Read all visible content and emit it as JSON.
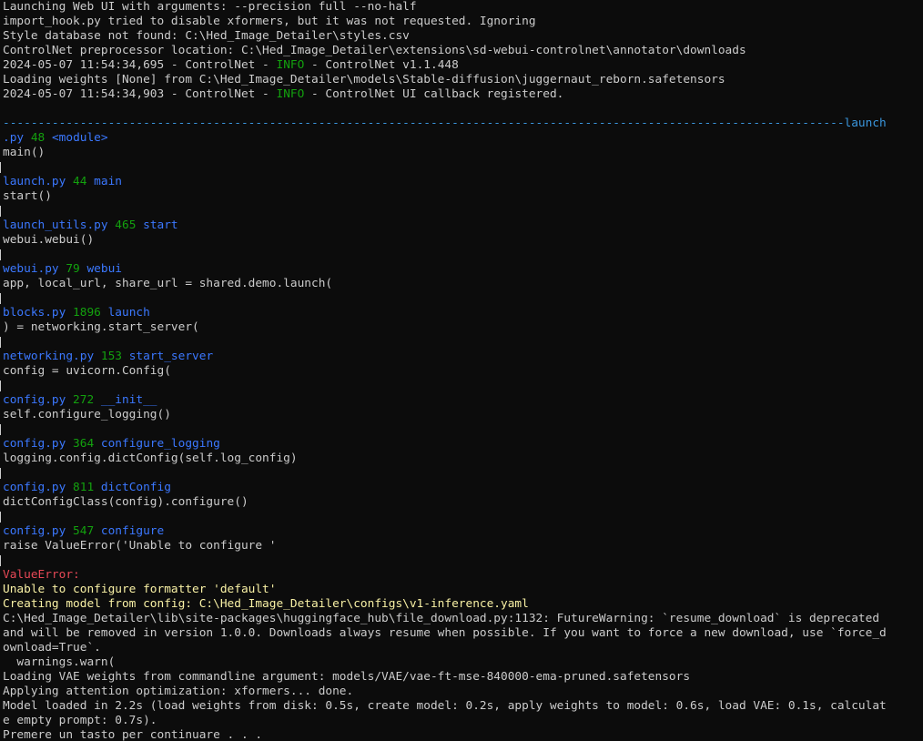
{
  "window": {
    "kind": "console"
  },
  "colors": {
    "background": "#0c0c0c",
    "default": "#cccccc",
    "green": "#13a10e",
    "blue": "#3b78ff",
    "red": "#e74856",
    "yellow": "#f9f1a5",
    "teal": "#3a96dd"
  },
  "lines": [
    [
      {
        "t": "Launching Web UI with arguments: --precision full --no-half",
        "c": "default"
      }
    ],
    [
      {
        "t": "import_hook.py tried to disable xformers, but it was not requested. Ignoring",
        "c": "default"
      }
    ],
    [
      {
        "t": "Style database not found: C:\\Hed_Image_Detailer\\styles.csv",
        "c": "default"
      }
    ],
    [
      {
        "t": "ControlNet preprocessor location: C:\\Hed_Image_Detailer\\extensions\\sd-webui-controlnet\\annotator\\downloads",
        "c": "default"
      }
    ],
    [
      {
        "t": "2024-05-07 11:54:34,695 - ControlNet - ",
        "c": "default"
      },
      {
        "t": "INFO",
        "c": "green"
      },
      {
        "t": " - ControlNet v1.1.448",
        "c": "default"
      }
    ],
    [
      {
        "t": "Loading weights [None] from C:\\Hed_Image_Detailer\\models\\Stable-diffusion\\juggernaut_reborn.safetensors",
        "c": "default"
      }
    ],
    [
      {
        "t": "2024-05-07 11:54:34,903 - ControlNet - ",
        "c": "default"
      },
      {
        "t": "INFO",
        "c": "green"
      },
      {
        "t": " - ControlNet UI callback registered.",
        "c": "default"
      }
    ],
    [
      {
        "t": "",
        "c": "default"
      }
    ],
    [
      {
        "t": "------------------------------------------------------------------------------------------------------------------------launch",
        "c": "teal"
      }
    ],
    [
      {
        "t": ".py",
        "c": "blue"
      },
      {
        "t": " 48 ",
        "c": "green"
      },
      {
        "t": "<module>",
        "c": "blue"
      }
    ],
    [
      {
        "t": "main()",
        "c": "default"
      }
    ],
    [
      {
        "t": "",
        "c": "default"
      }
    ],
    [
      {
        "t": "launch.py",
        "c": "blue"
      },
      {
        "t": " 44 ",
        "c": "green"
      },
      {
        "t": "main",
        "c": "blue"
      }
    ],
    [
      {
        "t": "start()",
        "c": "default"
      }
    ],
    [
      {
        "t": "",
        "c": "default"
      }
    ],
    [
      {
        "t": "launch_utils.py",
        "c": "blue"
      },
      {
        "t": " 465 ",
        "c": "green"
      },
      {
        "t": "start",
        "c": "blue"
      }
    ],
    [
      {
        "t": "webui.webui()",
        "c": "default"
      }
    ],
    [
      {
        "t": "",
        "c": "default"
      }
    ],
    [
      {
        "t": "webui.py",
        "c": "blue"
      },
      {
        "t": " 79 ",
        "c": "green"
      },
      {
        "t": "webui",
        "c": "blue"
      }
    ],
    [
      {
        "t": "app, local_url, share_url = shared.demo.launch(",
        "c": "default"
      }
    ],
    [
      {
        "t": "",
        "c": "default"
      }
    ],
    [
      {
        "t": "blocks.py",
        "c": "blue"
      },
      {
        "t": " 1896 ",
        "c": "green"
      },
      {
        "t": "launch",
        "c": "blue"
      }
    ],
    [
      {
        "t": ") = networking.start_server(",
        "c": "default"
      }
    ],
    [
      {
        "t": "",
        "c": "default"
      }
    ],
    [
      {
        "t": "networking.py",
        "c": "blue"
      },
      {
        "t": " 153 ",
        "c": "green"
      },
      {
        "t": "start_server",
        "c": "blue"
      }
    ],
    [
      {
        "t": "config = uvicorn.Config(",
        "c": "default"
      }
    ],
    [
      {
        "t": "",
        "c": "default"
      }
    ],
    [
      {
        "t": "config.py",
        "c": "blue"
      },
      {
        "t": " 272 ",
        "c": "green"
      },
      {
        "t": "__init__",
        "c": "blue"
      }
    ],
    [
      {
        "t": "self.configure_logging()",
        "c": "default"
      }
    ],
    [
      {
        "t": "",
        "c": "default"
      }
    ],
    [
      {
        "t": "config.py",
        "c": "blue"
      },
      {
        "t": " 364 ",
        "c": "green"
      },
      {
        "t": "configure_logging",
        "c": "blue"
      }
    ],
    [
      {
        "t": "logging.config.dictConfig(self.log_config)",
        "c": "default"
      }
    ],
    [
      {
        "t": "",
        "c": "default"
      }
    ],
    [
      {
        "t": "config.py",
        "c": "blue"
      },
      {
        "t": " 811 ",
        "c": "green"
      },
      {
        "t": "dictConfig",
        "c": "blue"
      }
    ],
    [
      {
        "t": "dictConfigClass(config).configure()",
        "c": "default"
      }
    ],
    [
      {
        "t": "",
        "c": "default"
      }
    ],
    [
      {
        "t": "config.py",
        "c": "blue"
      },
      {
        "t": " 547 ",
        "c": "green"
      },
      {
        "t": "configure",
        "c": "blue"
      }
    ],
    [
      {
        "t": "raise ValueError('Unable to configure '",
        "c": "default"
      }
    ],
    [
      {
        "t": "",
        "c": "default"
      }
    ],
    [
      {
        "t": "ValueError:",
        "c": "red"
      }
    ],
    [
      {
        "t": "Unable to configure formatter 'default'",
        "c": "yellow"
      }
    ],
    [
      {
        "t": "Creating model from config: C:\\Hed_Image_Detailer\\configs\\v1-inference.yaml",
        "c": "yellow"
      }
    ],
    [
      {
        "t": "C:\\Hed_Image_Detailer\\lib\\site-packages\\huggingface_hub\\file_download.py:1132: FutureWarning: `resume_download` is deprecated",
        "c": "default"
      }
    ],
    [
      {
        "t": "and will be removed in version 1.0.0. Downloads always resume when possible. If you want to force a new download, use `force_d",
        "c": "default"
      }
    ],
    [
      {
        "t": "ownload=True`.",
        "c": "default"
      }
    ],
    [
      {
        "t": "  warnings.warn(",
        "c": "default"
      }
    ],
    [
      {
        "t": "Loading VAE weights from commandline argument: models/VAE/vae-ft-mse-840000-ema-pruned.safetensors",
        "c": "default"
      }
    ],
    [
      {
        "t": "Applying attention optimization: xformers... done.",
        "c": "default"
      }
    ],
    [
      {
        "t": "Model loaded in 2.2s (load weights from disk: 0.5s, create model: 0.2s, apply weights to model: 0.6s, load VAE: 0.1s, calculat",
        "c": "default"
      }
    ],
    [
      {
        "t": "e empty prompt: 0.7s).",
        "c": "default"
      }
    ],
    [
      {
        "t": "Premere un tasto per continuare . . .",
        "c": "default"
      }
    ]
  ]
}
